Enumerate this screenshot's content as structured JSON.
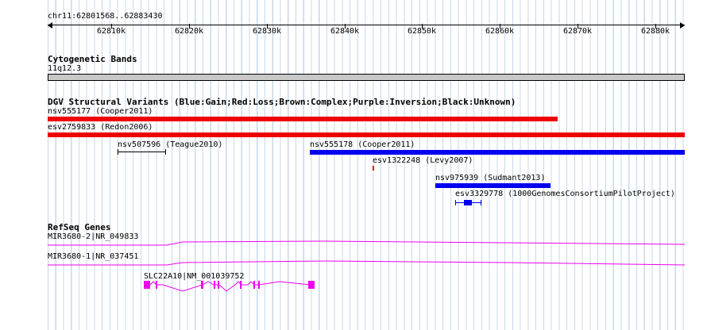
{
  "ruler": {
    "region": "chr11:62801568..62883430",
    "ticks": [
      "62810k",
      "62820k",
      "62830k",
      "62840k",
      "62850k",
      "62860k",
      "62870k",
      "62880k"
    ]
  },
  "cytoband": {
    "title": "Cytogenetic Bands",
    "band": "11q12.3"
  },
  "dgv": {
    "title": "DGV Structural Variants (Blue:Gain;Red:Loss;Brown:Complex;Purple:Inversion;Black:Unknown)",
    "features": [
      {
        "label": "nsv555177 (Cooper2011)"
      },
      {
        "label": "esv2759833 (Redon2006)"
      },
      {
        "label": "nsv507596 (Teague2010)"
      },
      {
        "label": "nsv555178 (Cooper2011)"
      },
      {
        "label": "esv1322248 (Levy2007)"
      },
      {
        "label": "nsv975939 (Sudmant2013)"
      },
      {
        "label": "esv3329778 (1000GenomesConsortiumPilotProject)"
      }
    ]
  },
  "refseq": {
    "title": "RefSeq Genes",
    "genes": [
      {
        "label": "MIR3680-2|NR_049833"
      },
      {
        "label": "MIR3680-1|NR_037451"
      },
      {
        "label": "SLC22A10|NM_001039752"
      }
    ]
  },
  "colors": {
    "gain": "#0000ee",
    "loss": "#ee0000",
    "unknown": "#000000",
    "gene": "#ee00ee",
    "grid": "#c4d9ee"
  }
}
